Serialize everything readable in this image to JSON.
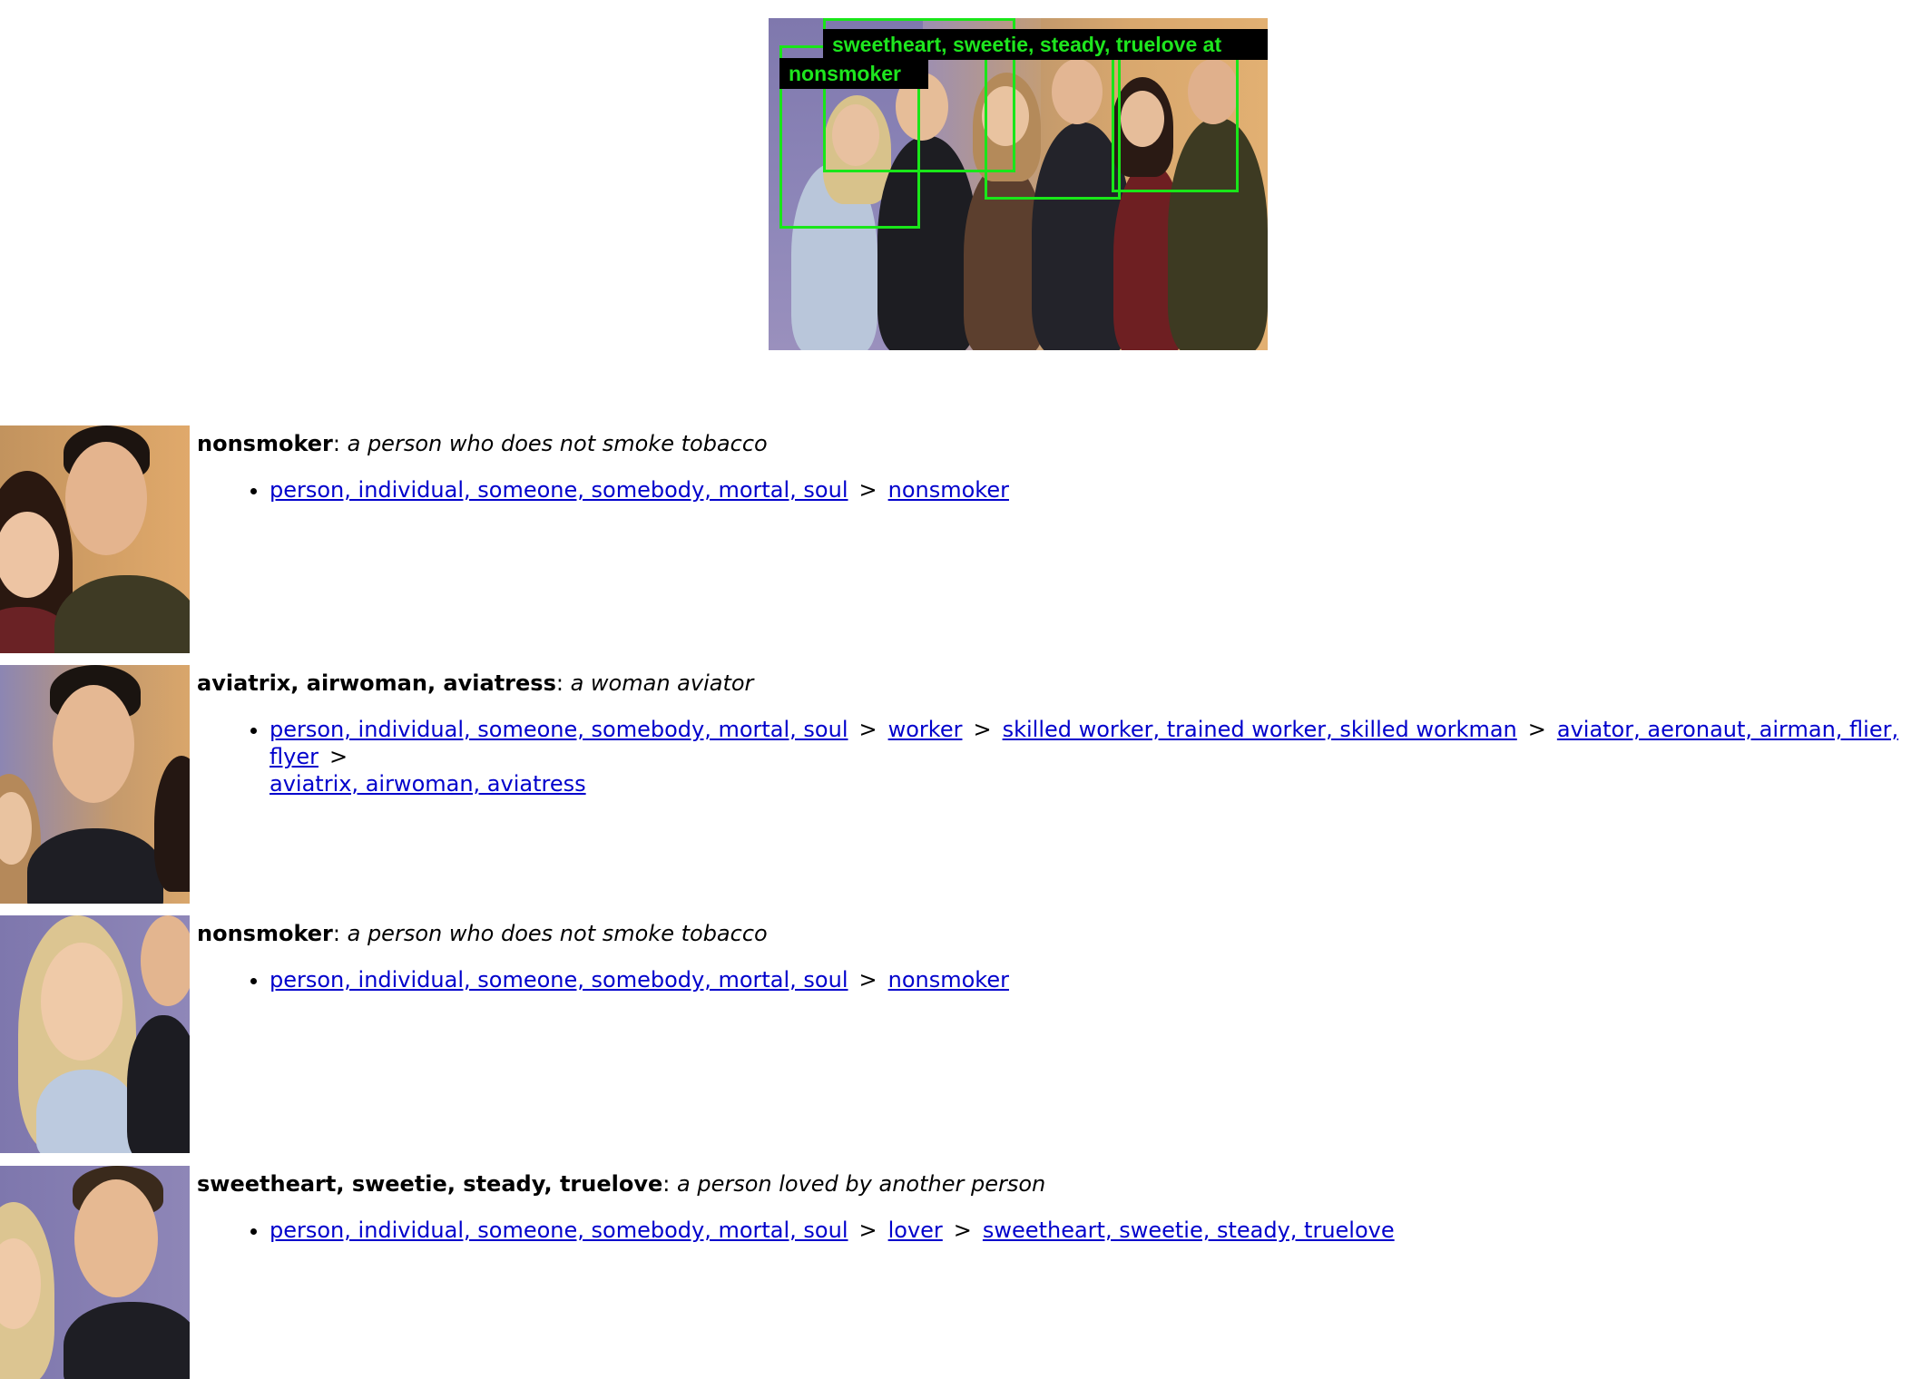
{
  "main_image": {
    "labels": [
      "sweetheart, sweetie, steady, truelove",
      "nonsmoker"
    ],
    "overflow_label": "at",
    "box_color": "#19e619"
  },
  "results": [
    {
      "term": "nonsmoker",
      "gloss": "a person who does not smoke tobacco",
      "path": [
        {
          "label": "person, individual, someone, somebody, mortal, soul"
        },
        {
          "label": "nonsmoker"
        }
      ]
    },
    {
      "term": "aviatrix, airwoman, aviatress",
      "gloss": "a woman aviator",
      "path": [
        {
          "label": "person, individual, someone, somebody, mortal, soul"
        },
        {
          "label": "worker"
        },
        {
          "label": "skilled worker, trained worker, skilled workman"
        },
        {
          "label": "aviator, aeronaut, airman, flier, flyer"
        },
        {
          "label": "aviatrix, airwoman, aviatress"
        }
      ]
    },
    {
      "term": "nonsmoker",
      "gloss": "a person who does not smoke tobacco",
      "path": [
        {
          "label": "person, individual, someone, somebody, mortal, soul"
        },
        {
          "label": "nonsmoker"
        }
      ]
    },
    {
      "term": "sweetheart, sweetie, steady, truelove",
      "gloss": "a person loved by another person",
      "path": [
        {
          "label": "person, individual, someone, somebody, mortal, soul"
        },
        {
          "label": "lover"
        },
        {
          "label": "sweetheart, sweetie, steady, truelove"
        }
      ]
    }
  ],
  "separator": ">",
  "colon": ":"
}
